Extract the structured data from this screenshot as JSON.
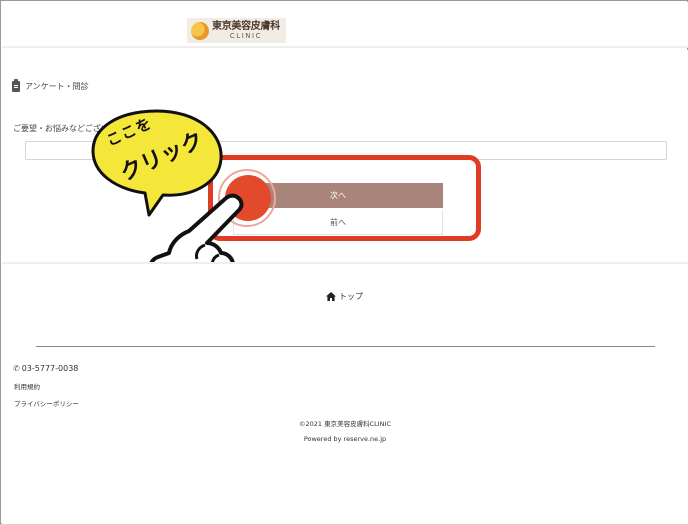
{
  "header": {
    "logo_jp": "東京美容皮膚科",
    "logo_en": "CLINIC"
  },
  "form": {
    "section_title": "アンケート・問診",
    "question_label": "ご要望・お悩みなどござい",
    "question_label_tail": "い",
    "answer_value": "",
    "next_label": "次へ",
    "prev_label": "前へ"
  },
  "annotation": {
    "line1": "ここを",
    "line2": "クリック",
    "bubble_color": "#f5e63a",
    "highlight_color": "#e03b25"
  },
  "footer": {
    "top_label": "トップ",
    "phone": "03-5777-0038",
    "terms": "利用規約",
    "privacy": "プライバシーポリシー",
    "copyright": "©2021 東京美容皮膚科CLINIC",
    "powered": "Powered by reserve.ne.jp"
  },
  "colors": {
    "accent_button": "#a8847a"
  }
}
